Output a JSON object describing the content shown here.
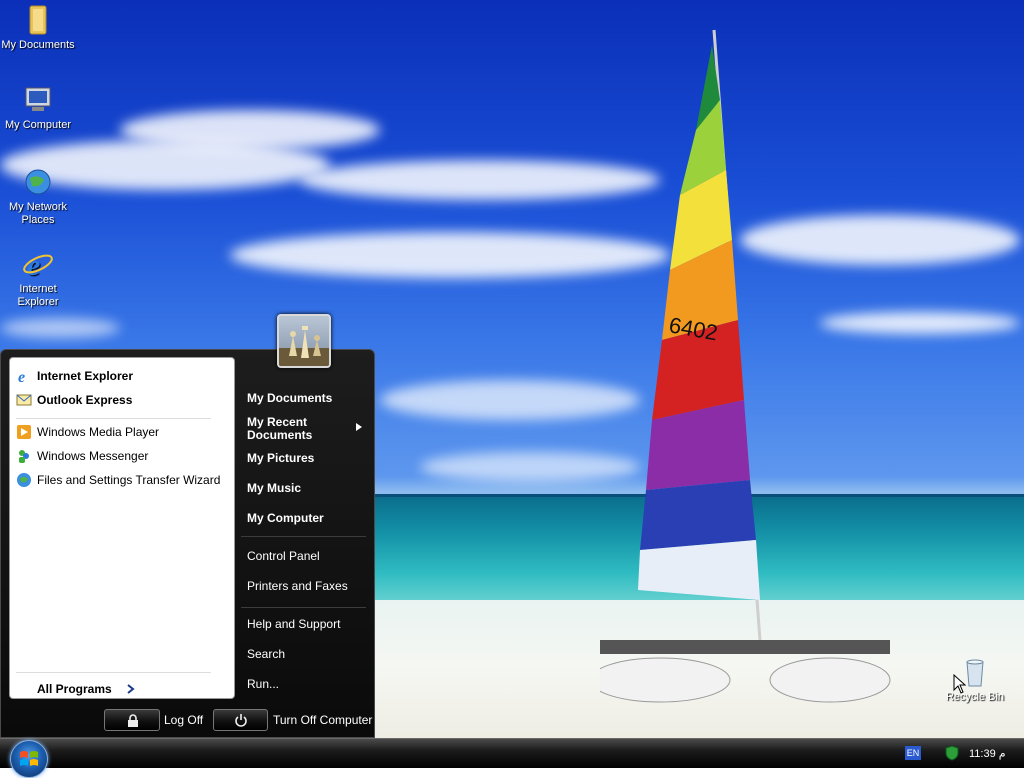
{
  "desktop": {
    "icons": [
      {
        "label": "My Documents"
      },
      {
        "label": "My Computer"
      },
      {
        "label": "My Network Places"
      },
      {
        "label": "Internet Explorer"
      },
      {
        "label": "Recycle Bin"
      }
    ],
    "sail_number": "6402"
  },
  "start_menu": {
    "pinned": [
      {
        "label": "Internet Explorer",
        "icon": "internet-explorer-icon"
      },
      {
        "label": "Outlook Express",
        "icon": "outlook-express-icon"
      }
    ],
    "recent": [
      {
        "label": "Windows Media Player",
        "icon": "media-player-icon"
      },
      {
        "label": "Windows Messenger",
        "icon": "messenger-icon"
      },
      {
        "label": "Files and Settings Transfer Wizard",
        "icon": "transfer-wizard-icon"
      }
    ],
    "all_programs": "All Programs",
    "places": [
      {
        "label": "My Documents"
      },
      {
        "label": "My Recent Documents"
      },
      {
        "label": "My Pictures"
      },
      {
        "label": "My Music"
      },
      {
        "label": "My Computer"
      }
    ],
    "system": [
      {
        "label": "Control Panel"
      },
      {
        "label": "Printers and Faxes"
      }
    ],
    "help": [
      {
        "label": "Help and Support"
      },
      {
        "label": "Search"
      },
      {
        "label": "Run..."
      }
    ],
    "log_off": "Log Off",
    "turn_off": "Turn Off Computer"
  },
  "taskbar": {
    "language": "EN",
    "clock": "11:39 م"
  },
  "colors": {
    "menu_bg": "#111111",
    "taskbar_bg": "#000000",
    "accent": "#1d5fb0"
  }
}
